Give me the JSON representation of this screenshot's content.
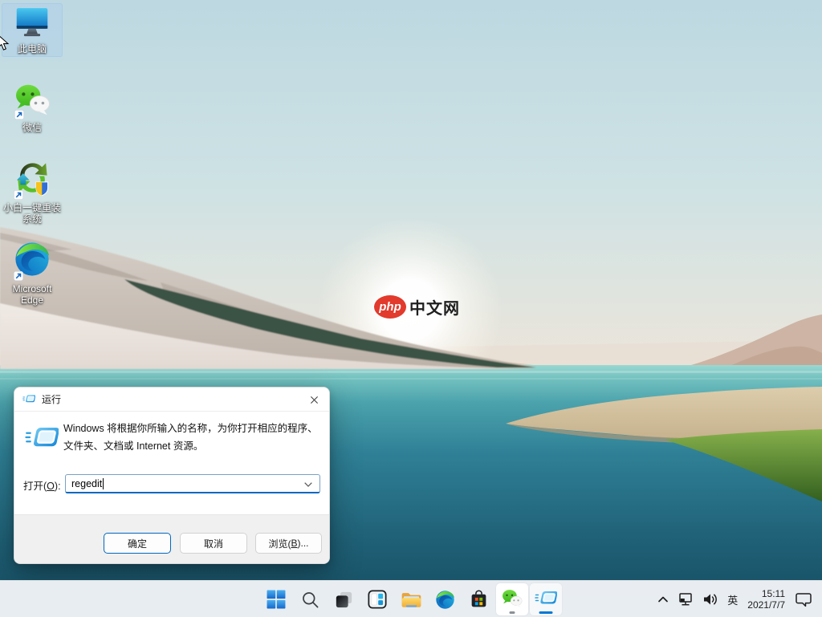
{
  "desktop": {
    "icons": [
      {
        "label": "此电脑",
        "selected": true,
        "shortcut": false
      },
      {
        "label": "微信",
        "selected": false,
        "shortcut": true
      },
      {
        "label": "小白一键重装系统",
        "selected": false,
        "shortcut": true
      },
      {
        "label": "Microsoft Edge",
        "selected": false,
        "shortcut": true
      }
    ],
    "watermark": {
      "badge": "php",
      "text": "中文网"
    }
  },
  "run_dialog": {
    "title": "运行",
    "description_line1": "Windows 将根据你所输入的名称，为你打开相应的程序、",
    "description_line2": "文件夹、文档或 Internet 资源。",
    "open_label": {
      "prefix": "打开(",
      "mnemonic": "O",
      "suffix": "):"
    },
    "input_value": "regedit",
    "buttons": {
      "ok": "确定",
      "cancel": "取消",
      "browse": {
        "prefix": "浏览(",
        "mnemonic": "B",
        "suffix": ")..."
      }
    }
  },
  "taskbar": {
    "icons": [
      "start",
      "search",
      "task-view",
      "widgets",
      "file-explorer",
      "edge",
      "store",
      "wechat",
      "run"
    ],
    "wechat_running": true,
    "run_active": true,
    "tray": {
      "ime": "英",
      "time": "15:11",
      "date": "2021/7/7"
    }
  },
  "colors": {
    "accent": "#0078d4",
    "ok_button_border": "#0067c0",
    "taskbar_bg": "#f1f4f7",
    "dialog_footer": "#f0f0f0",
    "wechat_green": "#4ec52c",
    "watermark_red": "#e23a2c",
    "water_teal": "#2f8096",
    "selection_highlight": "rgba(170,205,238,0.40)"
  }
}
